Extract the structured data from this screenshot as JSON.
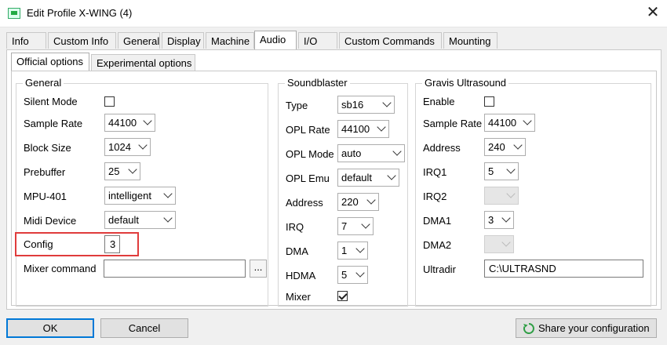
{
  "window": {
    "title": "Edit Profile X-WING (4)",
    "close_label": "✕"
  },
  "tabs": [
    "Info",
    "Custom Info",
    "General",
    "Display",
    "Machine",
    "Audio",
    "I/O",
    "Custom Commands",
    "Mounting"
  ],
  "subtabs": [
    "Official options",
    "Experimental options"
  ],
  "general": {
    "title": "General",
    "silent_mode_label": "Silent Mode",
    "sample_rate_label": "Sample Rate",
    "sample_rate": "44100",
    "block_size_label": "Block Size",
    "block_size": "1024",
    "prebuffer_label": "Prebuffer",
    "prebuffer": "25",
    "mpu_label": "MPU-401",
    "mpu": "intelligent",
    "midi_device_label": "Midi Device",
    "midi_device": "default",
    "config_label": "Config",
    "config": "3",
    "mixer_command_label": "Mixer command",
    "mixer_command": "",
    "browse_label": "..."
  },
  "soundblaster": {
    "title": "Soundblaster",
    "type_label": "Type",
    "type": "sb16",
    "opl_rate_label": "OPL Rate",
    "opl_rate": "44100",
    "opl_mode_label": "OPL Mode",
    "opl_mode": "auto",
    "opl_emu_label": "OPL Emu",
    "opl_emu": "default",
    "address_label": "Address",
    "address": "220",
    "irq_label": "IRQ",
    "irq": "7",
    "dma_label": "DMA",
    "dma": "1",
    "hdma_label": "HDMA",
    "hdma": "5",
    "mixer_label": "Mixer"
  },
  "gus": {
    "title": "Gravis Ultrasound",
    "enable_label": "Enable",
    "sample_rate_label": "Sample Rate",
    "sample_rate": "44100",
    "address_label": "Address",
    "address": "240",
    "irq1_label": "IRQ1",
    "irq1": "5",
    "irq2_label": "IRQ2",
    "dma1_label": "DMA1",
    "dma1": "3",
    "dma2_label": "DMA2",
    "ultradir_label": "Ultradir",
    "ultradir": "C:\\ULTRASND"
  },
  "buttons": {
    "ok": "OK",
    "cancel": "Cancel",
    "share": "Share your configuration"
  },
  "colors": {
    "highlight": "#e03c3c",
    "default_button_border": "#0078d7"
  }
}
